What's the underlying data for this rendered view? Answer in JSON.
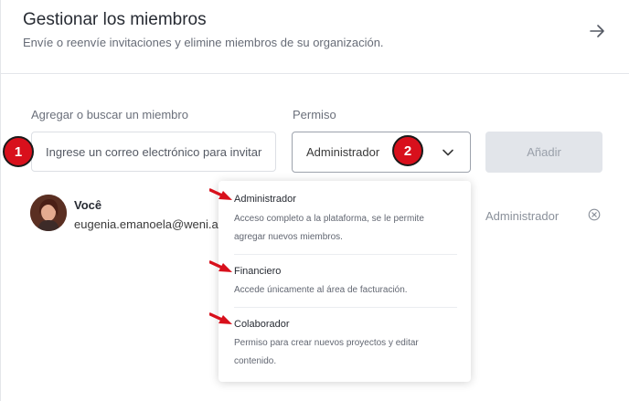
{
  "header": {
    "title": "Gestionar los miembros",
    "subtitle": "Envíe o reenvíe invitaciones y elimine miembros de su organización."
  },
  "form": {
    "member_label": "Agregar o buscar un miembro",
    "member_placeholder": "Ingrese un correo electrónico para invitar",
    "permission_label": "Permiso",
    "permission_value": "Administrador",
    "add_label": "Añadir"
  },
  "member": {
    "name": "Você",
    "email": "eugenia.emanoela@weni.ai",
    "role": "Administrador"
  },
  "dropdown": {
    "options": [
      {
        "title": "Administrador",
        "desc": "Acceso completo a la plataforma, se le permite agregar nuevos miembros."
      },
      {
        "title": "Financiero",
        "desc": "Accede únicamente al área de facturación."
      },
      {
        "title": "Colaborador",
        "desc": "Permiso para crear nuevos proyectos y editar contenido."
      }
    ]
  },
  "annotations": {
    "step1": "1",
    "step2": "2",
    "accent_color": "#d8101c"
  },
  "icons": {
    "close": "arrow-right-icon",
    "chevron": "chevron-down-icon",
    "remove": "circle-x-icon"
  }
}
